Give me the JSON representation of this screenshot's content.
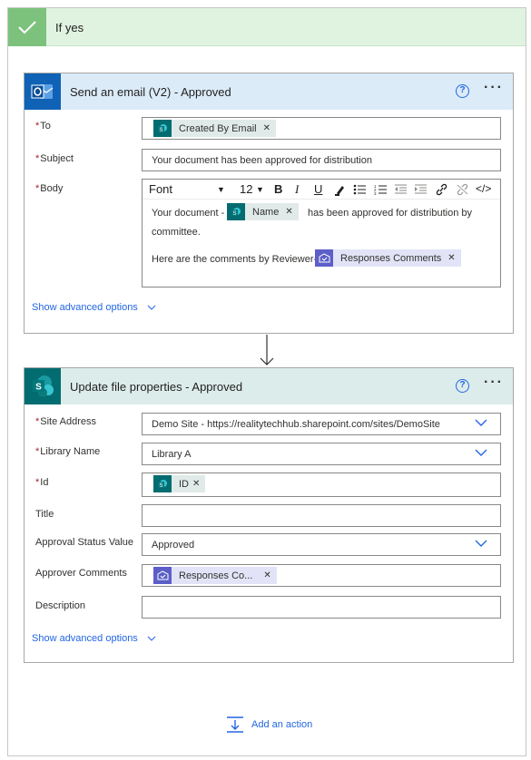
{
  "condition": {
    "title": "If yes"
  },
  "email_card": {
    "title": "Send an email (V2) - Approved",
    "to_label": "To",
    "to_token": "Created By Email",
    "subject_label": "Subject",
    "subject_value": "Your document has been approved for distribution",
    "body_label": "Body",
    "toolbar": {
      "font": "Font",
      "size": "12",
      "bold": "B",
      "italic": "I",
      "underline": "U"
    },
    "body_line1_pre": "Your document -",
    "body_name_token": "Name",
    "body_line1_post": "has been approved for distribution by",
    "body_line2": "committee.",
    "body_line3_pre": "Here are the comments by Reviewer-",
    "body_comments_token": "Responses Comments",
    "show_advanced": "Show advanced options",
    "help": "?",
    "more": "···"
  },
  "update_card": {
    "title": "Update file properties - Approved",
    "site_label": "Site Address",
    "site_value": "Demo Site - https://realitytechhub.sharepoint.com/sites/DemoSite",
    "library_label": "Library Name",
    "library_value": "Library A",
    "id_label": "Id",
    "id_token": "ID",
    "title_label": "Title",
    "title_value": "",
    "approval_label": "Approval Status Value",
    "approval_value": "Approved",
    "approver_label": "Approver Comments",
    "approver_token": "Responses Co...",
    "description_label": "Description",
    "description_value": "",
    "show_advanced": "Show advanced options",
    "help": "?",
    "more": "···"
  },
  "add_action": "Add an action",
  "colors": {
    "outlook_header": "#dcebf8",
    "sharepoint_header": "#dcecea",
    "outlook_icon": "#0f62b5",
    "sharepoint_icon": "#036c70",
    "approvals_icon": "#5b5fc7",
    "condition_green": "#7cc27c",
    "link_blue": "#2266e3"
  }
}
